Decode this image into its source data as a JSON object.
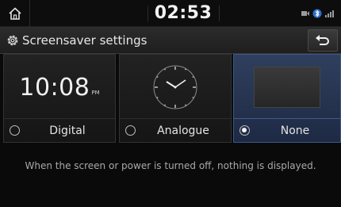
{
  "status_bar": {
    "time": "02:53"
  },
  "header": {
    "title": "Screensaver settings"
  },
  "options": [
    {
      "label": "Digital",
      "preview_time": "10:08",
      "preview_ampm": "PM",
      "selected": false
    },
    {
      "label": "Analogue",
      "selected": false
    },
    {
      "label": "None",
      "selected": true
    }
  ],
  "message": "When the screen or power is turned off, nothing is displayed.",
  "colors": {
    "selected_bg": "#2f3f5e",
    "accent_border": "#3c5784"
  },
  "icons": {
    "home": "home-icon",
    "settings": "gear-icon",
    "back": "back-arrow-icon"
  }
}
